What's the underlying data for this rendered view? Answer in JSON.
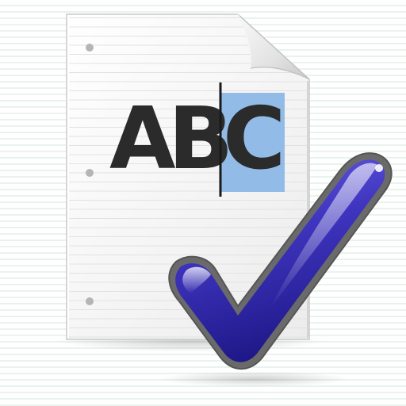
{
  "icon": {
    "name": "spell-check-document-icon",
    "text": "ABC",
    "letters": [
      "A",
      "B",
      "C"
    ],
    "selected_letter": "C",
    "colors": {
      "paper": "#f7f7f7",
      "paper_lines": "#dcdcdc",
      "letters": "#2b2b2b",
      "selection": "#8cb8e6",
      "caret": "#1a1a1a",
      "checkmark": "#4b3fc4",
      "checkmark_outline": "#6a6a6a"
    }
  }
}
